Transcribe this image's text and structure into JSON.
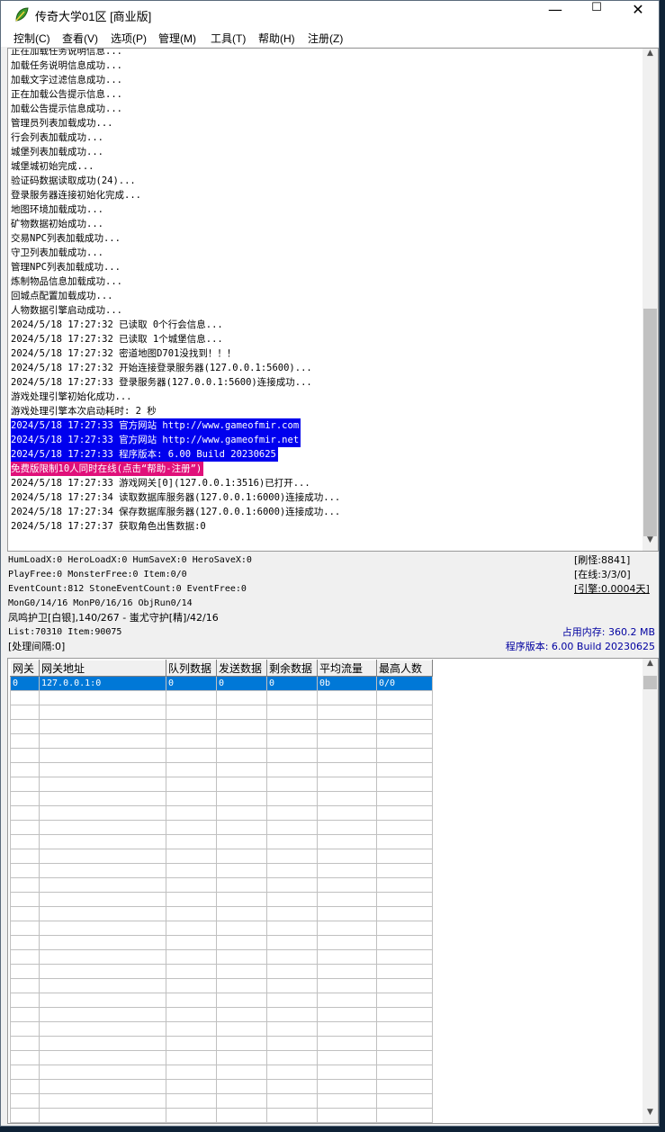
{
  "window": {
    "title": "传奇大学01区 [商业版]",
    "minimize": "—",
    "maximize": "☐",
    "close": "✕",
    "icon": "app-leaf-icon"
  },
  "menu": [
    "控制(C)",
    "查看(V)",
    "选项(P)",
    "管理(M)",
    "工具(T)",
    "帮助(H)",
    "注册(Z)"
  ],
  "log": {
    "lines": [
      {
        "text": "正在加载任务说明信息..."
      },
      {
        "text": "加载任务说明信息成功..."
      },
      {
        "text": "加载文字过滤信息成功..."
      },
      {
        "text": "正在加载公告提示信息..."
      },
      {
        "text": "加载公告提示信息成功..."
      },
      {
        "text": "管理员列表加载成功..."
      },
      {
        "text": "行会列表加载成功..."
      },
      {
        "text": "城堡列表加载成功..."
      },
      {
        "text": "城堡城初始完成..."
      },
      {
        "text": "验证码数据读取成功(24)..."
      },
      {
        "text": "登录服务器连接初始化完成..."
      },
      {
        "text": "地图环境加载成功..."
      },
      {
        "text": "矿物数据初始成功..."
      },
      {
        "text": "交易NPC列表加载成功..."
      },
      {
        "text": "守卫列表加载成功..."
      },
      {
        "text": "管理NPC列表加载成功..."
      },
      {
        "text": "炼制物品信息加载成功..."
      },
      {
        "text": "回城点配置加载成功..."
      },
      {
        "text": "人物数据引擎启动成功..."
      },
      {
        "text": "2024/5/18 17:27:32 已读取 0个行会信息..."
      },
      {
        "text": "2024/5/18 17:27:32 已读取 1个城堡信息..."
      },
      {
        "text": "2024/5/18 17:27:32 密道地图D701没找到！！！"
      },
      {
        "text": "2024/5/18 17:27:32 开始连接登录服务器(127.0.0.1:5600)..."
      },
      {
        "text": "2024/5/18 17:27:33 登录服务器(127.0.0.1:5600)连接成功..."
      },
      {
        "text": "游戏处理引擎初始化成功..."
      },
      {
        "text": "游戏处理引擎本次启动耗时: 2 秒"
      },
      {
        "text": "2024/5/18 17:27:33 官方网站 http://www.gameofmir.com",
        "hl": "blue"
      },
      {
        "text": "2024/5/18 17:27:33 官方网站 http://www.gameofmir.net",
        "hl": "blue"
      },
      {
        "text": "2024/5/18 17:27:33 程序版本: 6.00 Build 20230625",
        "hl": "blue"
      },
      {
        "text": "免费版限制10人同时在线(点击“帮助-注册”)",
        "hl": "pink"
      },
      {
        "text": "2024/5/18 17:27:33 游戏网关[0](127.0.0.1:3516)已打开..."
      },
      {
        "text": "2024/5/18 17:27:34 读取数据库服务器(127.0.0.1:6000)连接成功..."
      },
      {
        "text": "2024/5/18 17:27:34 保存数据库服务器(127.0.0.1:6000)连接成功..."
      },
      {
        "text": "2024/5/18 17:27:37 获取角色出售数据:0"
      }
    ]
  },
  "status": {
    "line1": "HumLoadX:0 HeroLoadX:0 HumSaveX:0 HeroSaveX:0",
    "line2": "PlayFree:0 MonsterFree:0 Item:0/0",
    "line3": "EventCount:812 StoneEventCount:0 EventFree:0",
    "line4": "MonG0/14/16 MonP0/16/16 ObjRun0/14",
    "line5": "凤鸣护卫[白银],140/267 - 蚩尤守护[精]/42/16",
    "line6": "List:70310 Item:90075",
    "line7": "[处理间隔:0]",
    "refresh_monsters": "[刷怪:8841]",
    "online": "[在线:3/3/0]",
    "engine": "[引擎:0.0004天]",
    "memory": "占用内存: 360.2 MB",
    "version": "程序版本: 6.00 Build 20230625"
  },
  "grid": {
    "headers": [
      "网关",
      "网关地址",
      "队列数据",
      "发送数据",
      "剩余数据",
      "平均流量",
      "最高人数"
    ],
    "rows": [
      [
        "0",
        "127.0.0.1:0",
        "0",
        "0",
        "0",
        "0b",
        "0/0"
      ]
    ],
    "empty_rows": 30
  }
}
